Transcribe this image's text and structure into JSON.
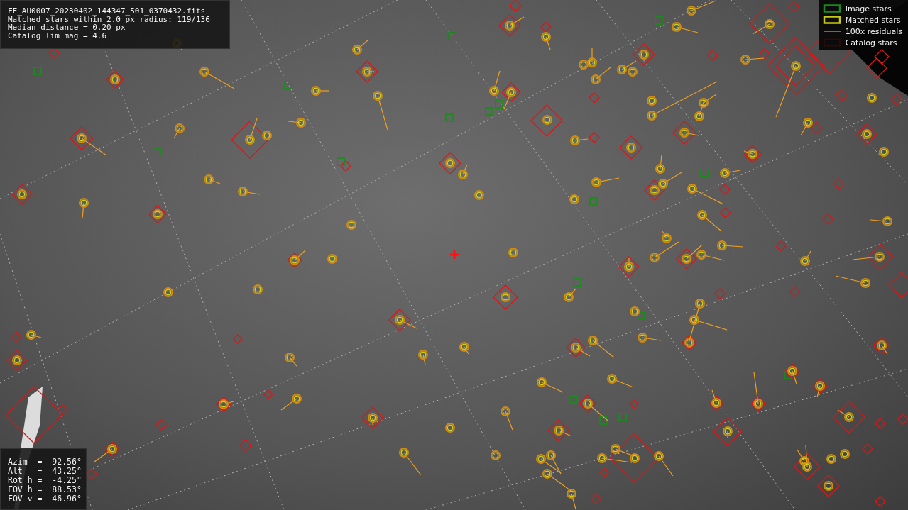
{
  "file_info": {
    "lines": [
      "FF_AU0007_20230402_144347_501_0370432.fits",
      "Matched stars within 2.0 px radius: 119/136",
      "Median distance = 0.20 px",
      "Catalog lim mag = 4.6"
    ]
  },
  "legend": {
    "items": [
      {
        "kind": "image",
        "label": "Image stars"
      },
      {
        "kind": "matched",
        "label": "Matched stars"
      },
      {
        "kind": "residual",
        "label": "100x residuals"
      },
      {
        "kind": "catalog",
        "label": "Catalog stars"
      }
    ]
  },
  "pointing": {
    "lines": [
      "Azim  =  92.56°",
      "Alt   =  43.25°",
      "Rot h =  -4.25°",
      "FOV h =  88.53°",
      "FOV v =  46.96°"
    ]
  }
}
